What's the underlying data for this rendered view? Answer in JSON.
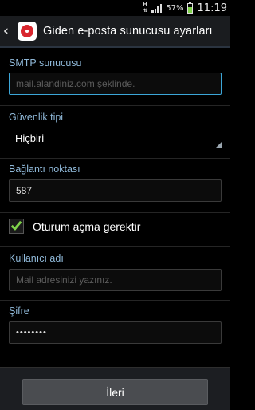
{
  "status_bar": {
    "network_type": "H",
    "battery_percent_text": "57%",
    "battery_level": 0.57,
    "time": "11:19",
    "signal_icon": "signal-bars-icon"
  },
  "title_bar": {
    "title": "Giden e-posta sunucusu ayarları",
    "back_icon": "back-arrow-icon",
    "app_icon": "email-app-icon"
  },
  "form": {
    "smtp": {
      "label": "SMTP sunucusu",
      "value": "",
      "placeholder": "mail.alandiniz.com şeklinde."
    },
    "security": {
      "label": "Güvenlik tipi",
      "selected": "Hiçbiri"
    },
    "port": {
      "label": "Bağlantı noktası",
      "value": "587"
    },
    "require_login": {
      "label": "Oturum açma gerektir",
      "checked": true
    },
    "username": {
      "label": "Kullanıcı adı",
      "value": "",
      "placeholder": "Mail adresinizi yazınız."
    },
    "password": {
      "label": "Şifre",
      "value": "••••••••"
    }
  },
  "footer": {
    "next_label": "İleri"
  },
  "colors": {
    "accent": "#3ca6d8",
    "label": "#8fb8d8",
    "check": "#7fd24a"
  }
}
